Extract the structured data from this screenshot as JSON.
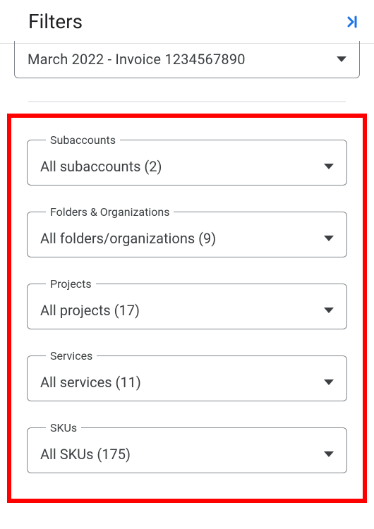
{
  "header": {
    "title": "Filters"
  },
  "invoice": {
    "value": "March 2022 - Invoice 1234567890"
  },
  "filters": {
    "subaccounts": {
      "label": "Subaccounts",
      "value": "All subaccounts (2)"
    },
    "folders": {
      "label": "Folders & Organizations",
      "value": "All folders/organizations (9)"
    },
    "projects": {
      "label": "Projects",
      "value": "All projects (17)"
    },
    "services": {
      "label": "Services",
      "value": "All services (11)"
    },
    "skus": {
      "label": "SKUs",
      "value": "All SKUs (175)"
    }
  }
}
